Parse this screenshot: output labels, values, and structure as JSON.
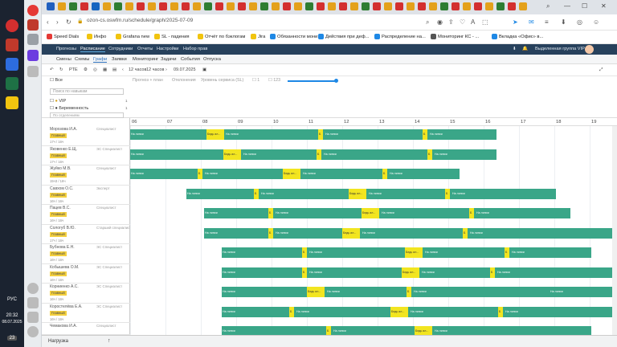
{
  "taskbar": {
    "lang": "РУС",
    "time": "20:32",
    "date": "08.07.2025",
    "badge": "23"
  },
  "browser": {
    "url": "ozon-cs.oswfm.ru/schedule/graph/2025-07-09",
    "workspace": "Выделенная группа VIP",
    "bookmarks": [
      "Speed Dials",
      "Инфо",
      "Grafana new",
      "SL - падения",
      "Отчёт по бэклогам",
      "Jira",
      "Обязанности мони...",
      "Действия при деф...",
      "Распределение на...",
      "Мониторинг КС - ...",
      "Вкладка «Офис» в..."
    ]
  },
  "appbar": {
    "items": [
      "Прогнозы",
      "Расписание",
      "Сотрудники",
      "Отчеты",
      "Настройки",
      "Набор прав"
    ]
  },
  "menubar": {
    "items": [
      "Смены",
      "Схемы",
      "Графи",
      "Заявки",
      "Мониторинг",
      "Задачи",
      "События",
      "Отпуска"
    ]
  },
  "toolbar": {
    "pte": "PTE",
    "interval1": "12 часов",
    "interval2": "12 часов",
    "date": "09.07.2025"
  },
  "filters": {
    "all": "Все",
    "search_placeholder": "Поиск по навыкам",
    "skills": [
      {
        "label": "VIP",
        "count": "1"
      },
      {
        "label": "Беременность",
        "count": "1"
      }
    ],
    "sort_placeholder": "По отделениям",
    "toggles": [
      "Прогноз + план",
      "Отклонения",
      "Уровень сервиса (SL)"
    ],
    "zoom_labels": [
      "1",
      "123"
    ]
  },
  "hours": [
    "06",
    "07",
    "08",
    "09",
    "10",
    "11",
    "12",
    "13",
    "14",
    "15",
    "16",
    "17",
    "18",
    "19"
  ],
  "employees": [
    {
      "name": "Морозова И.А.",
      "role": "Специалист",
      "badge": "Главный",
      "meta": "17ч / 16ч"
    },
    {
      "name": "Яковенко Е.Щ.",
      "role": "ЭС Специалист",
      "badge": "Главный",
      "meta": "17ч / 16ч"
    },
    {
      "name": "Жуйко М.В.",
      "role": "Специалист",
      "badge": "Главный",
      "meta": "15ч3 / 16ч"
    },
    {
      "name": "Савхом О.С.",
      "role": "Эксперт",
      "badge": "Главный",
      "meta": "16ч / 16ч"
    },
    {
      "name": "Пацев В.С.",
      "role": "Специалист",
      "badge": "Главный",
      "meta": "16ч / 16ч"
    },
    {
      "name": "Сологуб В.Ю.",
      "role": "Старший специалист",
      "badge": "Главный",
      "meta": "17ч / 16ч"
    },
    {
      "name": "Бубнова Е.Н.",
      "role": "ЭС Специалист",
      "badge": "Главный",
      "meta": "16ч / 16ч"
    },
    {
      "name": "Кобышева О.М.",
      "role": "ЭС Специалист",
      "badge": "Главный",
      "meta": "16ч / 16ч"
    },
    {
      "name": "Корниенко А.С.",
      "role": "ЭС Специалист",
      "badge": "Главный",
      "meta": "16ч / 16ч"
    },
    {
      "name": "Коростелёва Е.А.",
      "role": "ЭС Специалист",
      "badge": "Главный",
      "meta": "16ч / 16ч"
    },
    {
      "name": "Чемакова И.А.",
      "role": "Специалист",
      "badge": "Главный",
      "meta": "16ч / 16ч"
    }
  ],
  "segment_labels": {
    "work": "На линии",
    "break": "Б",
    "extra": "Бедь ил..."
  },
  "footer": {
    "label": "Нагрузка"
  }
}
